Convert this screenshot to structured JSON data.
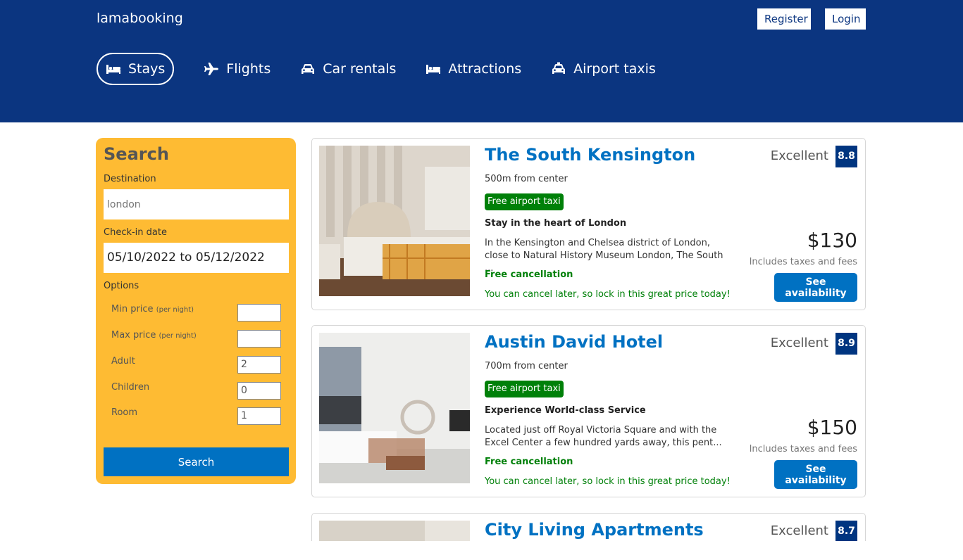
{
  "header": {
    "logo": "lamabooking",
    "register_label": "Register",
    "login_label": "Login",
    "nav": [
      {
        "label": "Stays",
        "icon": "bed-icon",
        "active": true
      },
      {
        "label": "Flights",
        "icon": "plane-icon"
      },
      {
        "label": "Car rentals",
        "icon": "car-icon"
      },
      {
        "label": "Attractions",
        "icon": "bed-icon"
      },
      {
        "label": "Airport taxis",
        "icon": "taxi-icon"
      }
    ]
  },
  "search": {
    "title": "Search",
    "destination_label": "Destination",
    "destination_placeholder": "london",
    "checkin_label": "Check-in date",
    "checkin_value": "05/10/2022 to 05/12/2022",
    "options_label": "Options",
    "min_price_label": "Min price",
    "max_price_label": "Max price",
    "per_night": "(per night)",
    "adult_label": "Adult",
    "adult_value": "2",
    "children_label": "Children",
    "children_value": "0",
    "room_label": "Room",
    "room_value": "1",
    "button_label": "Search"
  },
  "results": [
    {
      "title": "The South Kensington",
      "distance": "500m from center",
      "taxi": "Free airport taxi",
      "subtitle": "Stay in the heart of London",
      "description": "In the Kensington and Chelsea district of London, close to Natural History Museum London, The South ...",
      "cancel": "Free cancellation",
      "cancel_sub": "You can cancel later, so lock in this great price today!",
      "rating_text": "Excellent",
      "rating": "8.8",
      "price": "$130",
      "taxes": "Includes taxes and fees",
      "button": "See availability"
    },
    {
      "title": "Austin David Hotel",
      "distance": "700m from center",
      "taxi": "Free airport taxi",
      "subtitle": "Experience World-class Service",
      "description": "Located just off Royal Victoria Square and with the Excel Center a few hundred yards away, this pent...",
      "cancel": "Free cancellation",
      "cancel_sub": "You can cancel later, so lock in this great price today!",
      "rating_text": "Excellent",
      "rating": "8.9",
      "price": "$150",
      "taxes": "Includes taxes and fees",
      "button": "See availability"
    },
    {
      "title": "City Living Apartments",
      "rating_text": "Excellent",
      "rating": "8.7"
    }
  ],
  "colors": {
    "header_bg": "#0b3580",
    "accent": "#0071c2",
    "search_bg": "#febb33",
    "green": "#008009",
    "rating_bg": "#003580"
  }
}
